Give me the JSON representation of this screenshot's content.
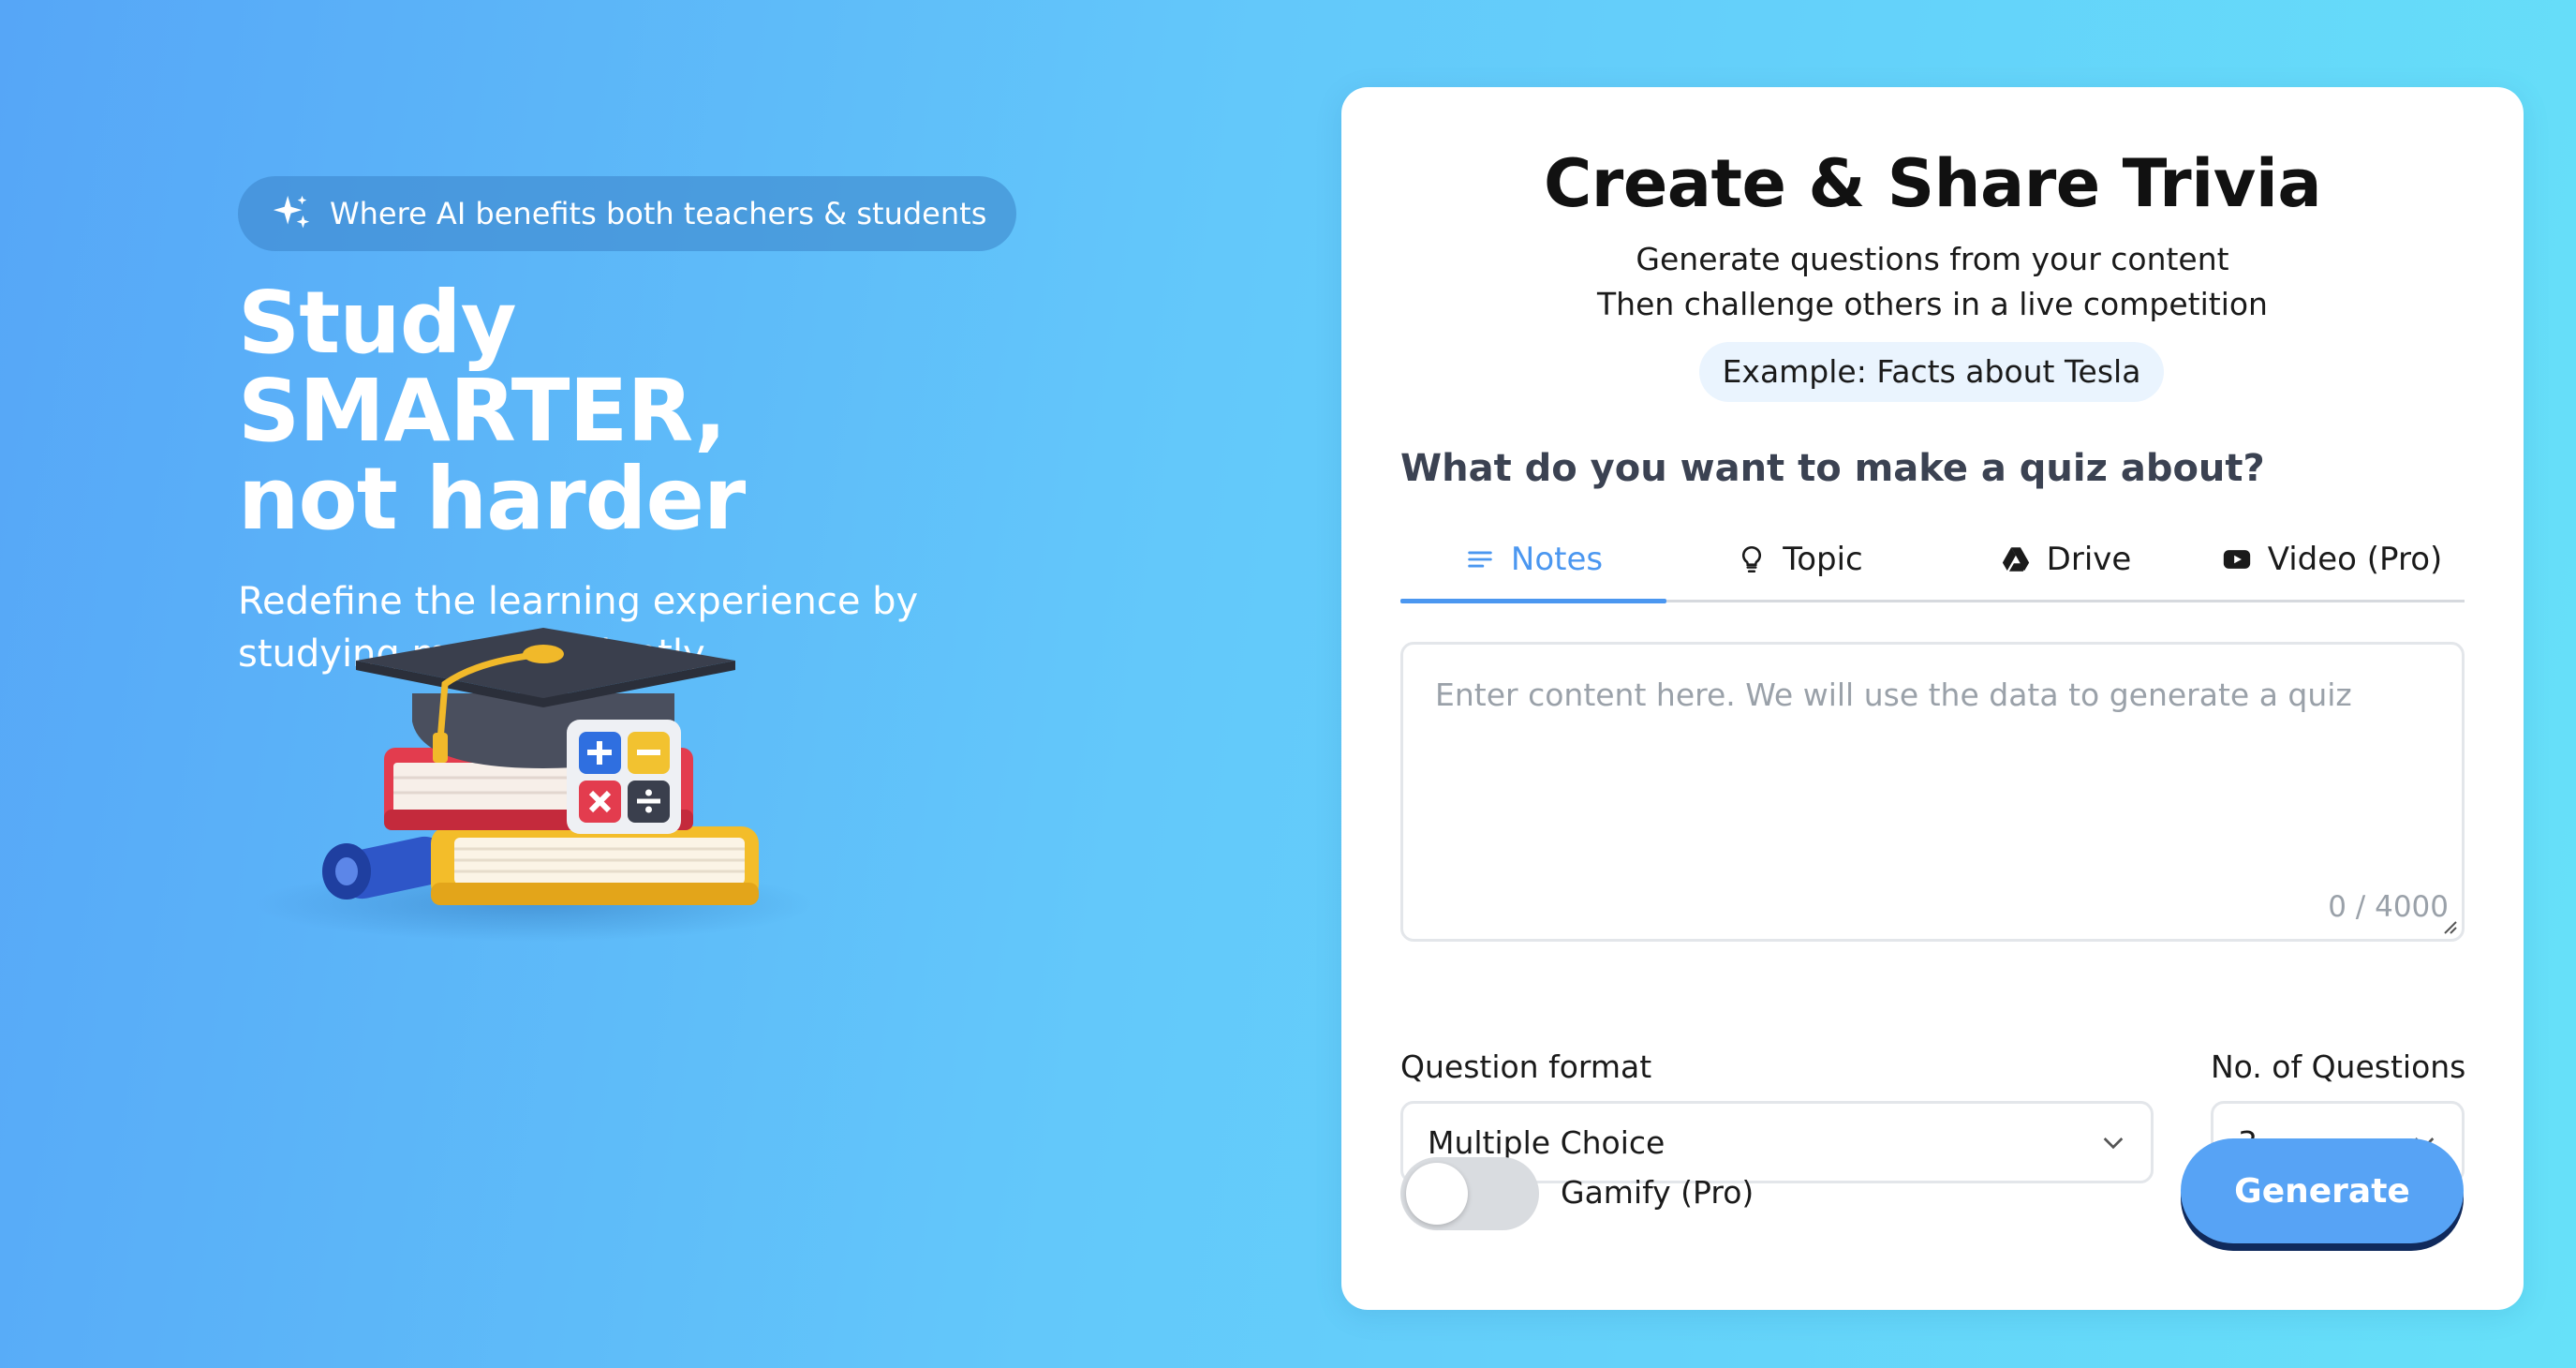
{
  "hero": {
    "pill_text": "Where AI benefits both teachers & students",
    "headline_line1": "Study SMARTER,",
    "headline_line2": "not harder",
    "subtitle": "Redefine the learning experience by studying more efficiently."
  },
  "card": {
    "title": "Create & Share Trivia",
    "subtitle_line1": "Generate questions from your content",
    "subtitle_line2": "Then challenge others in a live competition",
    "example": "Example: Facts about Tesla",
    "question": "What do you want to make a quiz about?",
    "tabs": [
      {
        "label": "Notes",
        "icon": "notes-icon",
        "active": true
      },
      {
        "label": "Topic",
        "icon": "lightbulb-icon"
      },
      {
        "label": "Drive",
        "icon": "google-drive-icon"
      },
      {
        "label": "Video (Pro)",
        "icon": "youtube-icon"
      }
    ],
    "content_placeholder": "Enter content here. We will use the data to generate a quiz",
    "content_value": "",
    "counter": "0 / 4000",
    "format_label": "Question format",
    "format_value": "Multiple Choice",
    "count_label": "No. of Questions",
    "count_value": "3",
    "gamify_label": "Gamify (Pro)",
    "gamify_on": false,
    "generate_label": "Generate"
  },
  "colors": {
    "accent": "#4b97f0",
    "button": "#57a3f5",
    "button_shadow": "#102a5c",
    "bg_start": "#56a6f7",
    "bg_end": "#66e1f9"
  }
}
